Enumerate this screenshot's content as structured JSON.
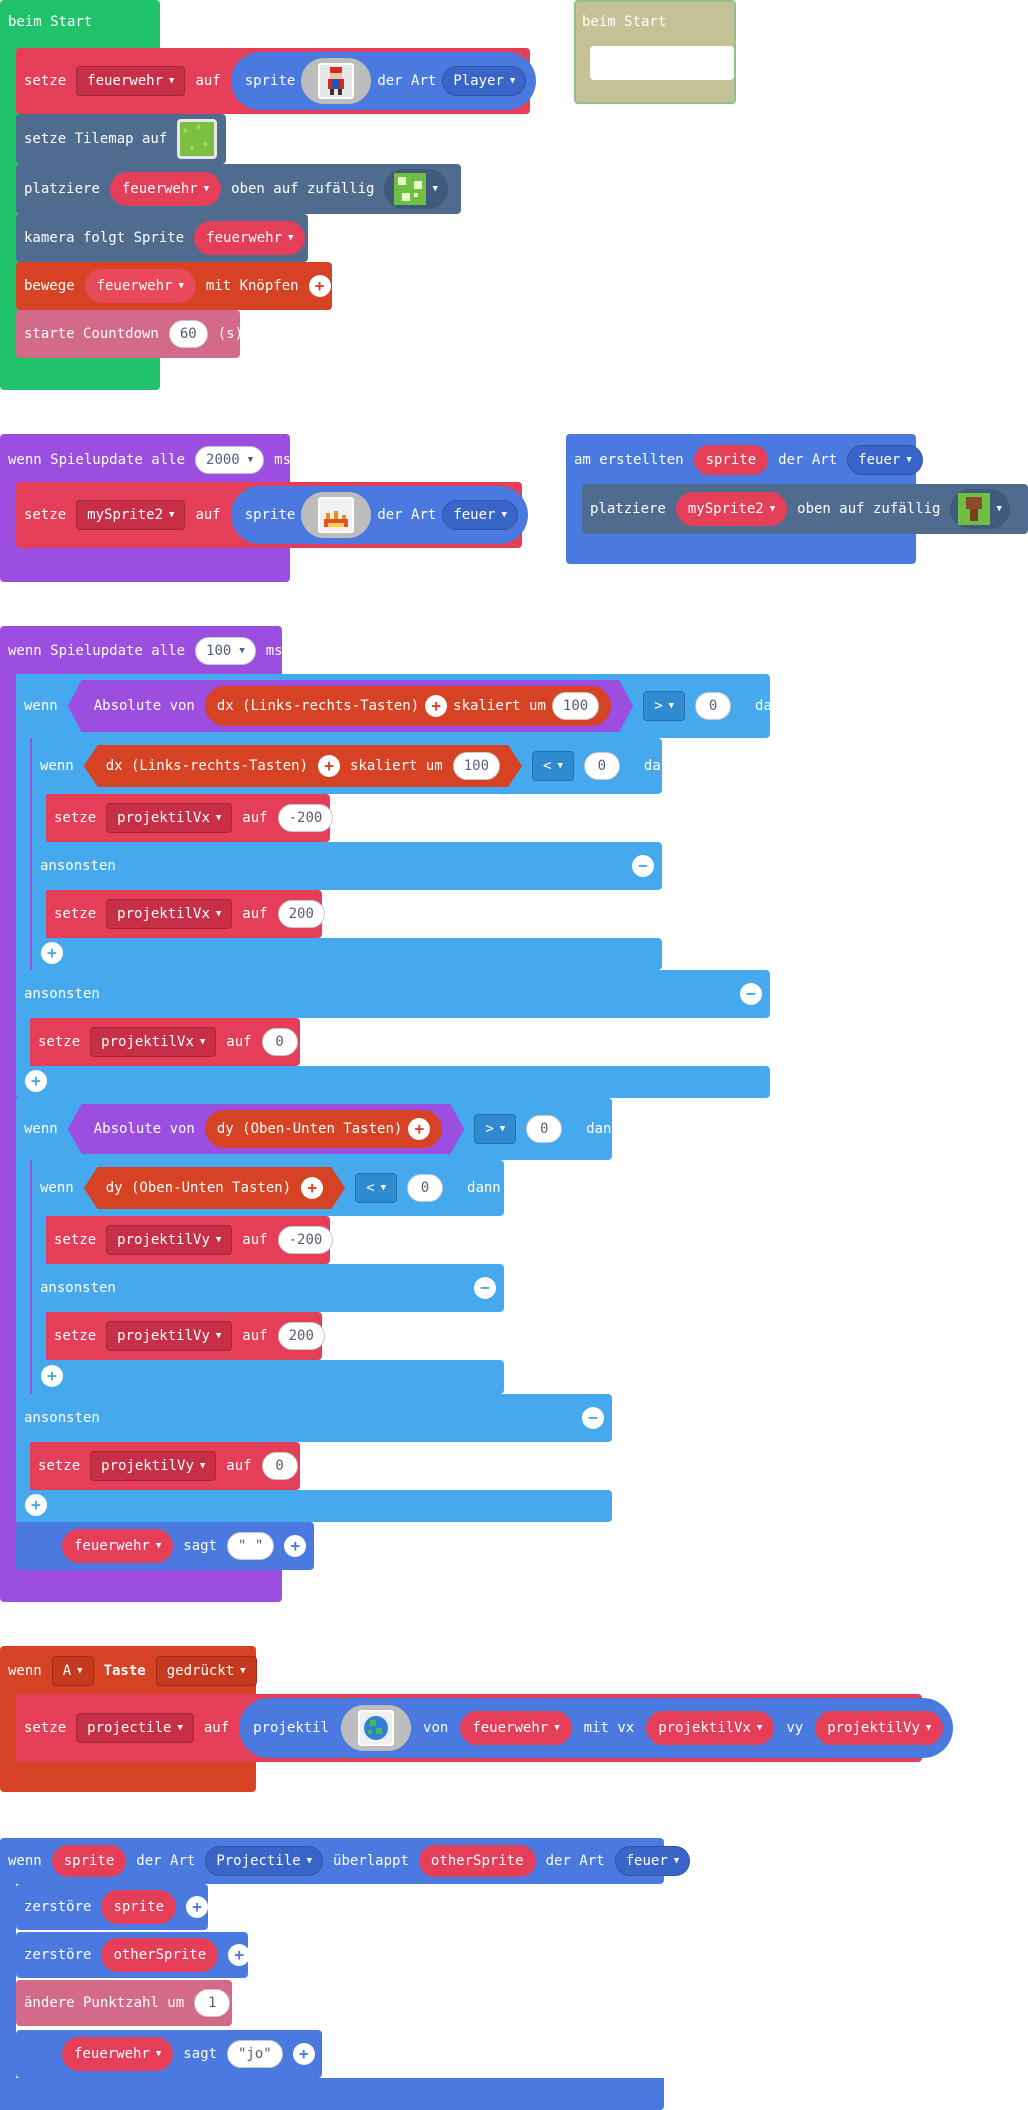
{
  "colors": {
    "start_green": "#21c36a",
    "sprite_red": "#e43e58",
    "sprite_blue": "#4a7ae0",
    "logic_sky": "#46a9ed",
    "game_purple": "#9b4ee0",
    "controller_orange": "#d64224",
    "scene_slate": "#4f6c8f",
    "info_pink": "#d46a8a"
  },
  "on_start": {
    "hat": "beim Start",
    "set_label": "setze",
    "set_var": "feuerwehr",
    "to_label": "auf",
    "sprite_label": "sprite",
    "kind_label": "der Art",
    "kind_value": "Player",
    "tilemap_label": "setze Tilemap auf",
    "place_label": "platziere",
    "place_var": "feuerwehr",
    "place_on_random": "oben auf zufällig",
    "camera_label": "kamera folgt Sprite",
    "camera_var": "feuerwehr",
    "move_label": "bewege",
    "move_var": "feuerwehr",
    "move_with_buttons": "mit Knöpfen",
    "countdown_label": "starte Countdown",
    "countdown_value": "60",
    "countdown_unit": "(s)"
  },
  "ghost_start": {
    "hat": "beim Start"
  },
  "update_2000": {
    "hat": "wenn Spielupdate alle",
    "interval": "2000",
    "unit": "ms",
    "set_label": "setze",
    "set_var": "mySprite2",
    "to_label": "auf",
    "sprite_label": "sprite",
    "kind_label": "der Art",
    "kind_value": "feuer"
  },
  "on_created": {
    "hat_label": "am erstellten",
    "hat_sprite": "sprite",
    "kind_label": "der Art",
    "kind_value": "feuer",
    "place_label": "platziere",
    "place_var": "mySprite2",
    "place_on_random": "oben auf zufällig"
  },
  "update_100": {
    "hat": "wenn Spielupdate alle",
    "interval": "100",
    "unit": "ms",
    "if_label": "wenn",
    "then_label": "dann",
    "else_label": "ansonsten",
    "abs_label": "Absolute von",
    "dx_label": "dx (Links-rechts-Tasten)",
    "dy_label": "dy (Oben-Unten Tasten)",
    "scaled_label": "skaliert um",
    "scale_value": "100",
    "gt_op": ">",
    "lt_op": "<",
    "zero": "0",
    "set_label": "setze",
    "to_label": "auf",
    "vx_var": "projektilVx",
    "vy_var": "projektilVy",
    "neg200": "-200",
    "pos200": "200",
    "say_var": "feuerwehr",
    "say_label": "sagt",
    "say_text": "\" \""
  },
  "on_button_a": {
    "hat_label": "wenn",
    "button": "A",
    "key_label": "Taste",
    "event": "gedrückt",
    "set_label": "setze",
    "set_var": "projectile",
    "to_label": "auf",
    "projectile_label": "projektil",
    "from_label": "von",
    "from_var": "feuerwehr",
    "vx_label": "mit vx",
    "vx_var": "projektilVx",
    "vy_label": "vy",
    "vy_var": "projektilVy"
  },
  "on_overlap": {
    "hat_label": "wenn",
    "sprite": "sprite",
    "kind_label": "der Art",
    "kind_value": "Projectile",
    "overlaps_label": "überlappt",
    "other": "otherSprite",
    "kind_label2": "der Art",
    "kind_value2": "feuer",
    "destroy_label": "zerstöre",
    "destroy_a": "sprite",
    "destroy_b": "otherSprite",
    "score_label": "ändere Punktzahl um",
    "score_value": "1",
    "say_var": "feuerwehr",
    "say_label": "sagt",
    "say_text": "\"jo\""
  }
}
